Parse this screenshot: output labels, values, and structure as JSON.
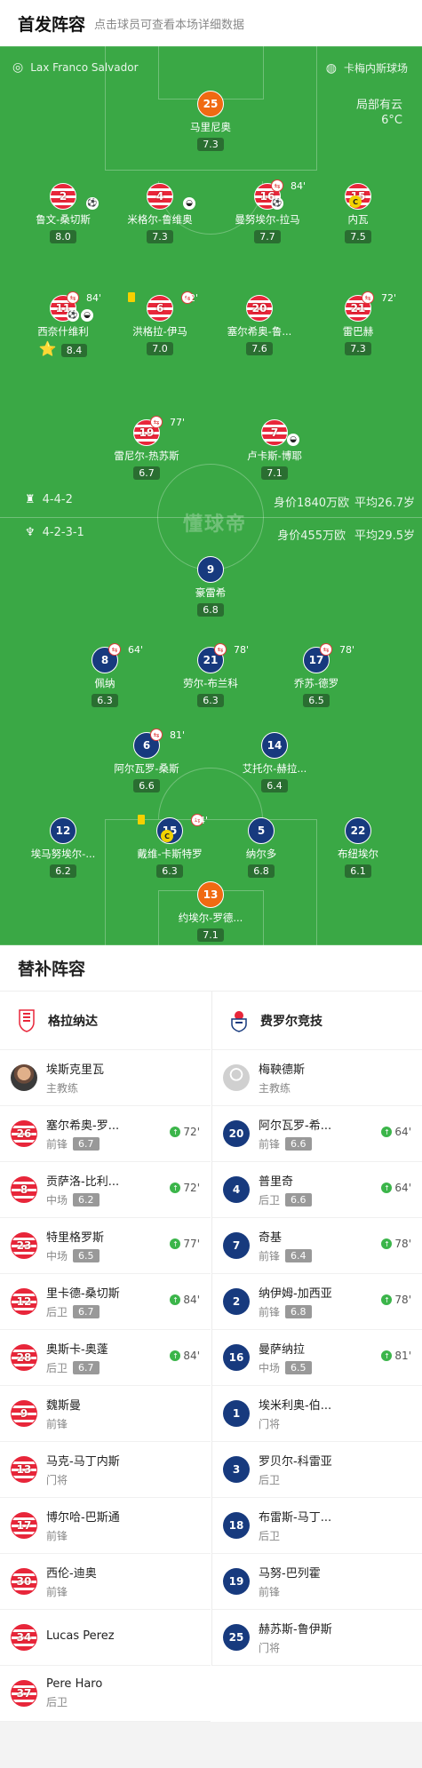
{
  "header": {
    "title": "首发阵容",
    "subtitle": "点击球员可查看本场详细数据"
  },
  "venue": {
    "home": "Lax Franco Salvador",
    "away": "卡梅内斯球场"
  },
  "weather": {
    "desc": "局部有云",
    "temp": "6°C"
  },
  "watermark": "懂球帝",
  "home_form": {
    "formation": "4-4-2",
    "value": "身价1840万欧",
    "age": "平均26.7岁"
  },
  "away_form": {
    "formation": "4-2-3-1",
    "value": "身价455万欧",
    "age": "平均29.5岁"
  },
  "home_players": [
    {
      "num": "25",
      "name": "马里尼奥",
      "rating": "7.3"
    },
    {
      "num": "2",
      "name": "鲁文-桑切斯",
      "rating": "8.0"
    },
    {
      "num": "4",
      "name": "米格尔-鲁维奥",
      "rating": "7.3"
    },
    {
      "num": "16",
      "name": "曼努埃尔-拉马",
      "rating": "7.7",
      "min": "84'"
    },
    {
      "num": "15",
      "name": "内瓦",
      "rating": "7.5"
    },
    {
      "num": "11",
      "name": "西奈什维利",
      "rating": "8.4",
      "min": "84'"
    },
    {
      "num": "6",
      "name": "洪格拉-伊马",
      "rating": "7.0",
      "min": "72'"
    },
    {
      "num": "20",
      "name": "塞尔希奥-鲁...",
      "rating": "7.6"
    },
    {
      "num": "21",
      "name": "雷巴赫",
      "rating": "7.3",
      "min": "72'"
    },
    {
      "num": "19",
      "name": "雷尼尔-热苏斯",
      "rating": "6.7",
      "min": "77'"
    },
    {
      "num": "7",
      "name": "卢卡斯-博耶",
      "rating": "7.1"
    }
  ],
  "away_players": [
    {
      "num": "9",
      "name": "豪雷希",
      "rating": "6.8"
    },
    {
      "num": "8",
      "name": "佩纳",
      "rating": "6.3",
      "min": "64'"
    },
    {
      "num": "21",
      "name": "劳尔-布兰科",
      "rating": "6.3",
      "min": "78'"
    },
    {
      "num": "17",
      "name": "乔苏-德罗",
      "rating": "6.5",
      "min": "78'"
    },
    {
      "num": "6",
      "name": "阿尔瓦罗-桑斯",
      "rating": "6.6",
      "min": "81'"
    },
    {
      "num": "14",
      "name": "艾托尔-赫拉...",
      "rating": "6.4"
    },
    {
      "num": "12",
      "name": "埃马努埃尔-...",
      "rating": "6.2"
    },
    {
      "num": "15",
      "name": "戴维-卡斯特罗",
      "rating": "6.3",
      "min": "64'"
    },
    {
      "num": "5",
      "name": "纳尔多",
      "rating": "6.8"
    },
    {
      "num": "22",
      "name": "布纽埃尔",
      "rating": "6.1"
    },
    {
      "num": "13",
      "name": "约埃尔-罗德...",
      "rating": "7.1"
    }
  ],
  "bench_title": "替补阵容",
  "home_team": "格拉纳达",
  "away_team": "费罗尔竞技",
  "home_coach": {
    "name": "埃斯克里瓦",
    "role": "主教练"
  },
  "away_coach": {
    "name": "梅鞅德斯",
    "role": "主教练"
  },
  "home_subs": [
    {
      "num": "26",
      "name": "塞尔希奥-罗...",
      "pos": "前锋",
      "rating": "6.7",
      "min": "72'"
    },
    {
      "num": "8",
      "name": "贡萨洛-比利...",
      "pos": "中场",
      "rating": "6.2",
      "min": "72'"
    },
    {
      "num": "23",
      "name": "特里格罗斯",
      "pos": "中场",
      "rating": "6.5",
      "min": "77'"
    },
    {
      "num": "12",
      "name": "里卡德-桑切斯",
      "pos": "后卫",
      "rating": "6.7",
      "min": "84'"
    },
    {
      "num": "28",
      "name": "奥斯卡-奥蓬",
      "pos": "后卫",
      "rating": "6.7",
      "min": "84'"
    },
    {
      "num": "9",
      "name": "魏斯曼",
      "pos": "前锋"
    },
    {
      "num": "13",
      "name": "马克-马丁内斯",
      "pos": "门将"
    },
    {
      "num": "17",
      "name": "博尔哈-巴斯通",
      "pos": "前锋"
    },
    {
      "num": "30",
      "name": "西伦-迪奥",
      "pos": "前锋"
    },
    {
      "num": "34",
      "name": "Lucas Perez",
      "pos": ""
    },
    {
      "num": "37",
      "name": "Pere Haro",
      "pos": "后卫"
    }
  ],
  "away_subs": [
    {
      "num": "20",
      "name": "阿尔瓦罗-希...",
      "pos": "前锋",
      "rating": "6.6",
      "min": "64'"
    },
    {
      "num": "4",
      "name": "普里奇",
      "pos": "后卫",
      "rating": "6.6",
      "min": "64'"
    },
    {
      "num": "7",
      "name": "奇基",
      "pos": "前锋",
      "rating": "6.4",
      "min": "78'"
    },
    {
      "num": "2",
      "name": "纳伊姆-加西亚",
      "pos": "前锋",
      "rating": "6.8",
      "min": "78'"
    },
    {
      "num": "16",
      "name": "曼萨纳拉",
      "pos": "中场",
      "rating": "6.5",
      "min": "81'"
    },
    {
      "num": "1",
      "name": "埃米利奥-伯...",
      "pos": "门将"
    },
    {
      "num": "3",
      "name": "罗贝尔-科雷亚",
      "pos": "后卫"
    },
    {
      "num": "18",
      "name": "布雷斯-马丁...",
      "pos": "后卫"
    },
    {
      "num": "19",
      "name": "马努-巴列霍",
      "pos": "前锋"
    },
    {
      "num": "25",
      "name": "赫苏斯-鲁伊斯",
      "pos": "门将"
    }
  ],
  "colors": {
    "pitch": "#3aa845",
    "home": "#e8263a",
    "away": "#173a7e",
    "gk": "#f06a12"
  }
}
